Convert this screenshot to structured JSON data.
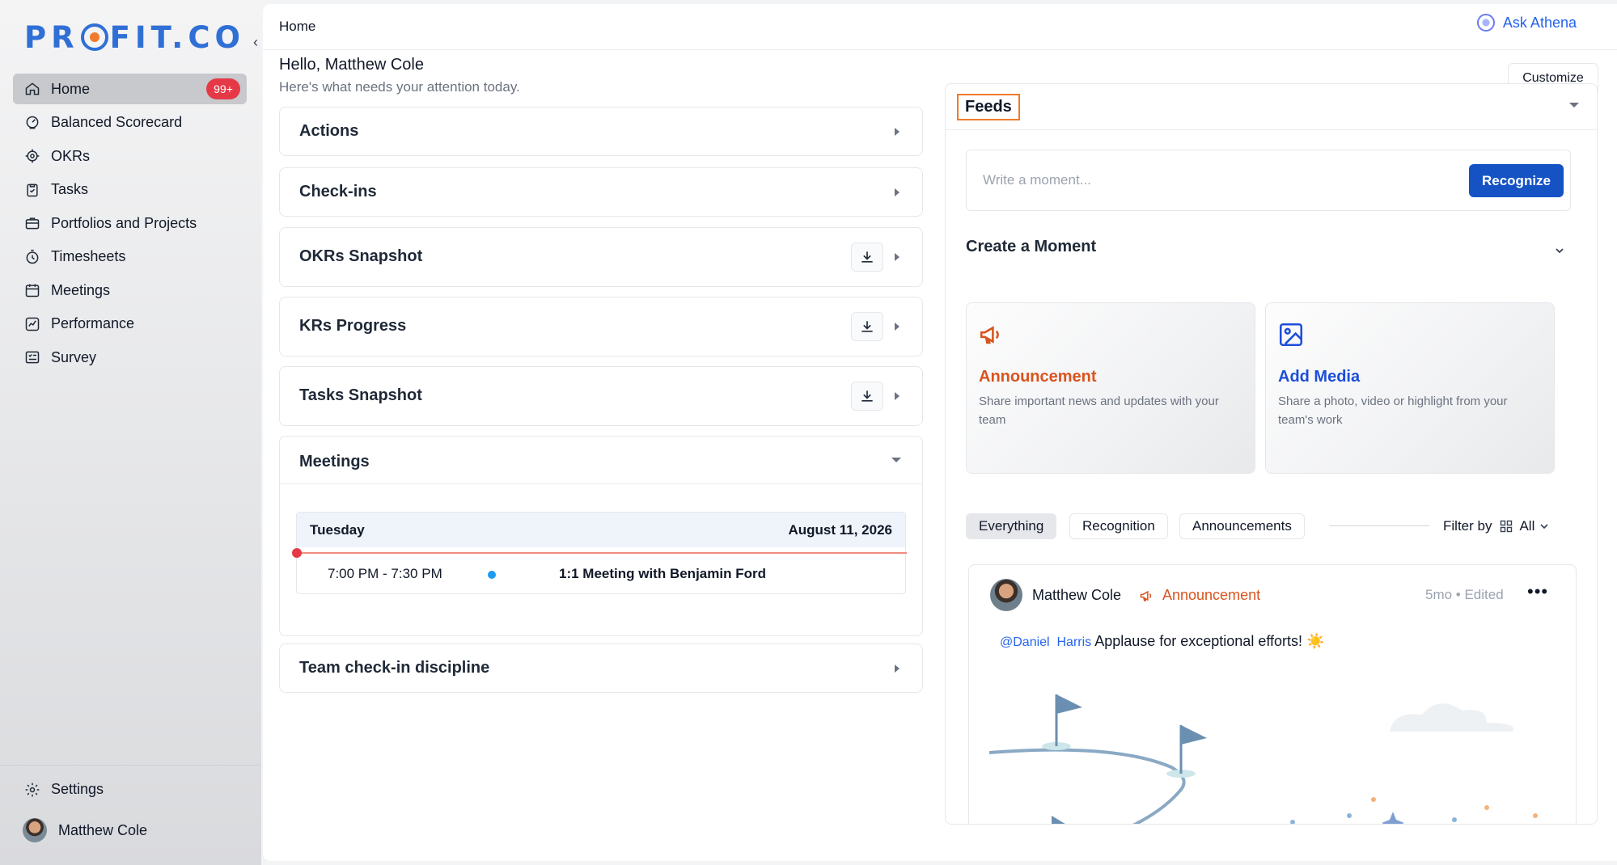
{
  "brand": {
    "logo_left": "PR",
    "logo_right": "FIT.CO"
  },
  "sidebar": {
    "items": [
      {
        "label": "Home",
        "icon": "home-icon",
        "badge": "99+"
      },
      {
        "label": "Balanced Scorecard",
        "icon": "scorecard-icon"
      },
      {
        "label": "OKRs",
        "icon": "target-icon"
      },
      {
        "label": "Tasks",
        "icon": "clipboard-check-icon"
      },
      {
        "label": "Portfolios and Projects",
        "icon": "briefcase-icon"
      },
      {
        "label": "Timesheets",
        "icon": "stopwatch-icon"
      },
      {
        "label": "Meetings",
        "icon": "calendar-icon"
      },
      {
        "label": "Performance",
        "icon": "chart-line-icon"
      },
      {
        "label": "Survey",
        "icon": "survey-list-icon"
      }
    ],
    "settings_label": "Settings",
    "user_name": "Matthew Cole"
  },
  "topbar": {
    "breadcrumb": "Home",
    "ask_athena": "Ask Athena"
  },
  "header": {
    "greeting": "Hello, Matthew Cole",
    "subtitle": "Here's what needs your attention today.",
    "customize_label": "Customize"
  },
  "widgets": {
    "actions": "Actions",
    "checkins": "Check-ins",
    "okrs_snapshot": "OKRs Snapshot",
    "krs_progress": "KRs Progress",
    "tasks_snapshot": "Tasks Snapshot",
    "meetings": "Meetings",
    "team_checkin": "Team check-in discipline"
  },
  "meetings": {
    "day": "Tuesday",
    "date": "August 11, 2026",
    "rows": [
      {
        "time": "7:00 PM - 7:30 PM",
        "title": "1:1 Meeting with Benjamin Ford"
      }
    ]
  },
  "feeds": {
    "title": "Feeds",
    "moment_placeholder": "Write a moment...",
    "recognize_label": "Recognize",
    "create_title": "Create a Moment",
    "tiles": [
      {
        "title": "Announcement",
        "desc": "Share important news and updates with your team",
        "color": "#d9531e",
        "icon": "megaphone-icon"
      },
      {
        "title": "Add Media",
        "desc": "Share a photo, video or highlight from your team's work",
        "color": "#1d4ed8",
        "icon": "image-icon"
      }
    ],
    "filters": [
      "Everything",
      "Recognition",
      "Announcements"
    ],
    "active_filter": "Everything",
    "filter_by_label": "Filter by",
    "filter_value": "All"
  },
  "post": {
    "author": "Matthew Cole",
    "type": "Announcement",
    "meta": "5mo • Edited",
    "more": "•••",
    "mention_first": "@Daniel",
    "mention_last": "Harris",
    "text": "Applause for exceptional efforts! ☀️"
  },
  "colors": {
    "accent": "#1553c4",
    "badge": "#e53947",
    "announcement": "#d9531e",
    "logo": "#2f6fd6"
  }
}
